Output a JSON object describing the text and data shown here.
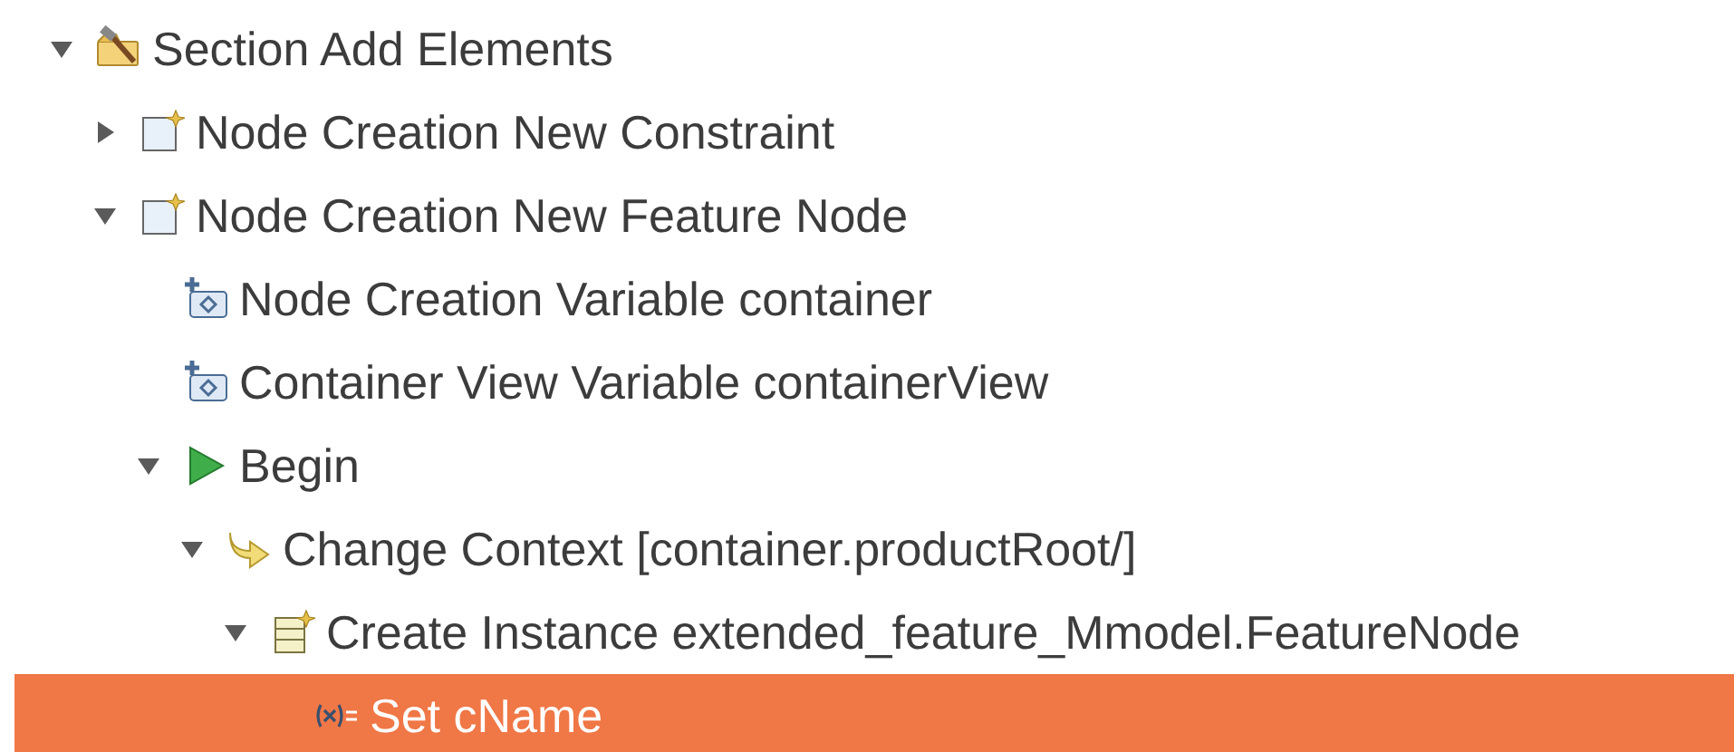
{
  "tree": [
    {
      "label": "Section Add Elements",
      "kind": "section",
      "expanded": true,
      "selected": false,
      "children": [
        {
          "label": "Node Creation New Constraint",
          "kind": "creation",
          "expanded": false,
          "selected": false
        },
        {
          "label": "Node Creation New Feature Node",
          "kind": "creation",
          "expanded": true,
          "selected": false,
          "children": [
            {
              "label": "Node Creation Variable container",
              "kind": "variable",
              "selected": false
            },
            {
              "label": "Container View Variable containerView",
              "kind": "variable",
              "selected": false
            },
            {
              "label": "Begin",
              "kind": "begin",
              "expanded": true,
              "selected": false,
              "children": [
                {
                  "label": "Change Context [container.productRoot/]",
                  "kind": "context",
                  "expanded": true,
                  "selected": false,
                  "children": [
                    {
                      "label": "Create Instance extended_feature_Mmodel.FeatureNode",
                      "kind": "instance",
                      "expanded": true,
                      "selected": false,
                      "children": [
                        {
                          "label": "Set cName",
                          "kind": "set",
                          "selected": true
                        }
                      ]
                    }
                  ]
                }
              ]
            }
          ]
        }
      ]
    }
  ]
}
